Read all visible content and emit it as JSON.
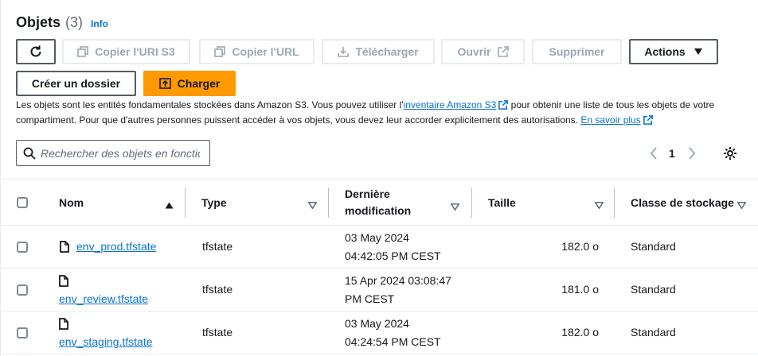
{
  "header": {
    "title": "Objets",
    "count": "(3)",
    "info": "Info"
  },
  "toolbar": {
    "copy_uri": "Copier l'URI S3",
    "copy_url": "Copier l'URL",
    "download": "Télécharger",
    "open": "Ouvrir",
    "delete": "Supprimer",
    "actions": "Actions",
    "create_folder": "Créer un dossier",
    "upload": "Charger"
  },
  "description": {
    "part1": "Les objets sont les entités fondamentales stockées dans Amazon S3. Vous pouvez utiliser l'",
    "link1": "inventaire Amazon S3",
    "part2": " pour obtenir une liste de tous les objets de votre compartiment. Pour que d'autres personnes puissent accéder à vos objets, vous devez leur accorder explicitement des autorisations. ",
    "link2": "En savoir plus"
  },
  "search": {
    "placeholder": "Rechercher des objets en fonction du préfixe"
  },
  "pagination": {
    "page": "1"
  },
  "table": {
    "columns": {
      "name": "Nom",
      "type": "Type",
      "modified_line1": "Dernière",
      "modified_line2": "modification",
      "size": "Taille",
      "storage": "Classe de stockage"
    },
    "rows": [
      {
        "name": "env_prod.tfstate",
        "type": "tfstate",
        "modified_line1": "03 May 2024",
        "modified_line2": "04:42:05 PM CEST",
        "size": "182.0 o",
        "storage": "Standard"
      },
      {
        "name": "env_review.tfstate",
        "type": "tfstate",
        "modified_line1": "15 Apr 2024 03:08:47",
        "modified_line2": "PM CEST",
        "size": "181.0 o",
        "storage": "Standard"
      },
      {
        "name": "env_staging.tfstate",
        "type": "tfstate",
        "modified_line1": "03 May 2024",
        "modified_line2": "04:24:54 PM CEST",
        "size": "182.0 o",
        "storage": "Standard"
      }
    ]
  }
}
